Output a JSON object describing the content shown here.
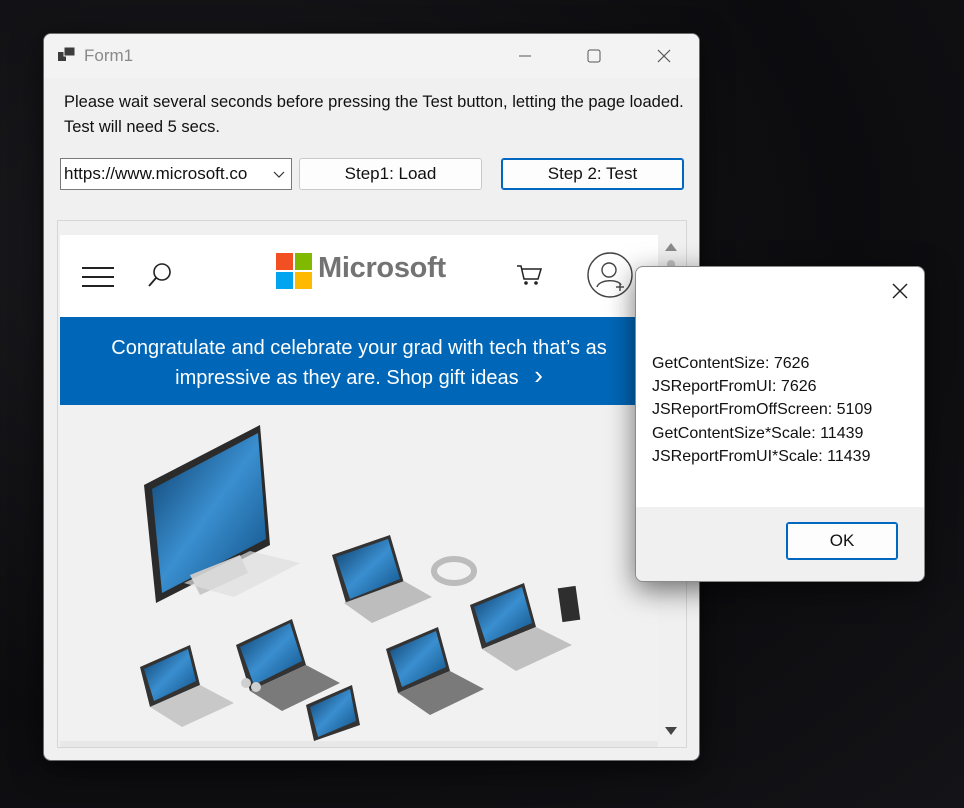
{
  "window": {
    "title": "Form1",
    "instructions": "Please wait several seconds before pressing the Test button, letting the page loaded. Test will need 5 secs.",
    "url_value": "https://www.microsoft.co",
    "load_button": "Step1: Load",
    "test_button": "Step 2: Test"
  },
  "web_page": {
    "logo_text": "Microsoft",
    "banner_line1": "Congratulate and celebrate your grad with tech that’s as",
    "banner_line2": "impressive as they are. Shop gift ideas",
    "banner_arrow": "›",
    "banner_color": "#0067b8",
    "logo_colors": [
      "#f25022",
      "#7fba00",
      "#00a4ef",
      "#ffb900"
    ],
    "icons": [
      "hamburger-menu-icon",
      "search-icon",
      "cart-icon",
      "account-icon"
    ]
  },
  "dialog": {
    "lines": [
      "GetContentSize: 7626",
      "JSReportFromUI: 7626",
      "JSReportFromOffScreen: 5109",
      "GetContentSize*Scale: 11439",
      "JSReportFromUI*Scale: 11439"
    ],
    "ok_label": "OK"
  }
}
